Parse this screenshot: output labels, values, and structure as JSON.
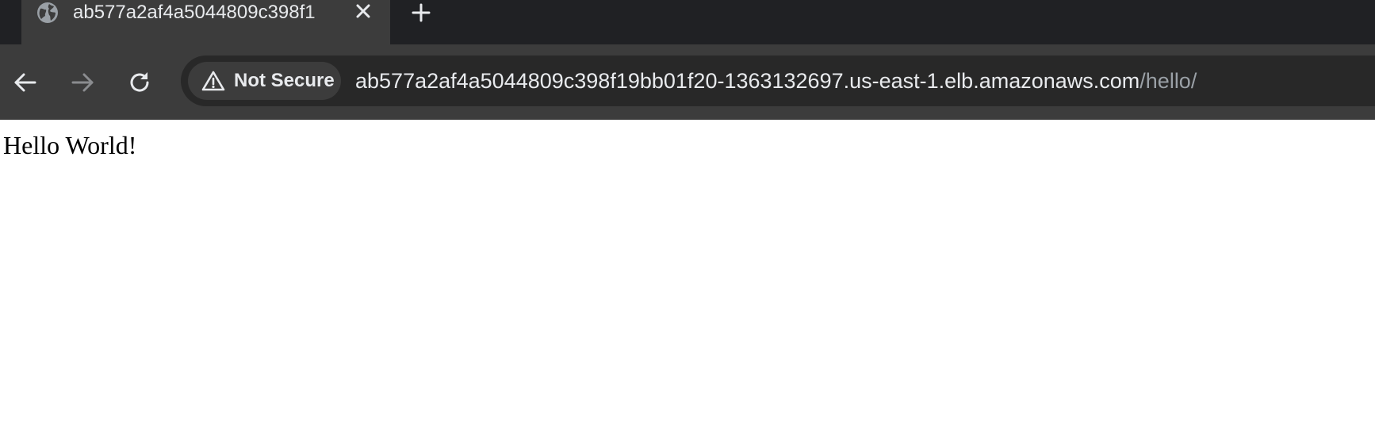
{
  "colors": {
    "tabstrip_bg": "#202124",
    "active_tab_bg": "#3c3c3c",
    "toolbar_bg": "#3c3c3c",
    "omnibox_bg": "#282828",
    "text_primary": "#e8eaed",
    "text_dim": "#9aa0a6",
    "page_bg": "#ffffff"
  },
  "tabs": [
    {
      "title": "ab577a2af4a5044809c398f1",
      "favicon": "globe-icon",
      "close_icon": "close-icon"
    }
  ],
  "new_tab_icon": "plus-icon",
  "toolbar": {
    "back_icon": "arrow-left-icon",
    "forward_icon": "arrow-right-icon",
    "reload_icon": "reload-icon"
  },
  "omnibox": {
    "security_icon": "warning-triangle-icon",
    "security_label": "Not Secure",
    "url_host": "ab577a2af4a5044809c398f19bb01f20-1363132697.us-east-1.elb.amazonaws.com",
    "url_path": "/hello/"
  },
  "page": {
    "text": "Hello World!"
  }
}
